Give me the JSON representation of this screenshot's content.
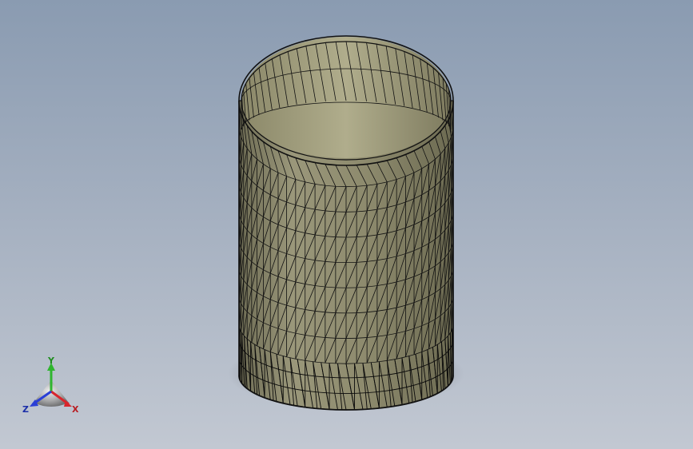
{
  "viewport": {
    "background_top": "#8a9bb1",
    "background_bottom": "#c2c8d2"
  },
  "model": {
    "name": "cylinder-shell",
    "display_mode": "shaded-with-edges",
    "face_color": "#8f8c6e",
    "inner_color": "#a9a685",
    "edge_color": "#111111",
    "vertical_segments": 64,
    "horizontal_bands": 7
  },
  "triad": {
    "x_label": "X",
    "y_label": "Y",
    "z_label": "Z",
    "x_color": "#d8262c",
    "y_color": "#2fb52f",
    "z_color": "#2a3fd6"
  }
}
